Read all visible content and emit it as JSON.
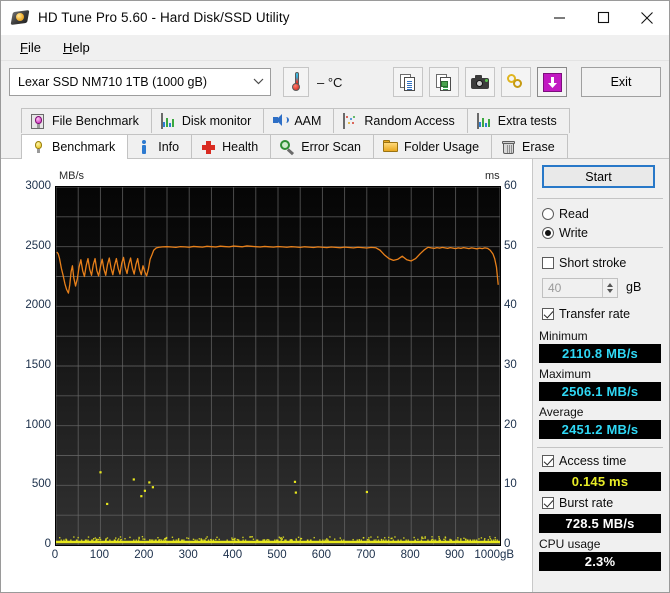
{
  "window": {
    "title": "HD Tune Pro 5.60 - Hard Disk/SSD Utility",
    "minimize": "–",
    "maximize": "□",
    "close": "✕"
  },
  "menu": {
    "items": [
      {
        "label": "File"
      },
      {
        "label": "Help"
      }
    ]
  },
  "toolbar": {
    "drive_value": "Lexar SSD NM710 1TB (1000 gB)",
    "drive_chevron": "⌄",
    "temperature": "– °C",
    "buttons": [
      {
        "name": "copy-to-clipboard-button",
        "icon": "copy-icon"
      },
      {
        "name": "copy-image-button",
        "icon": "copy-image-icon"
      },
      {
        "name": "screenshot-button",
        "icon": "camera-icon"
      },
      {
        "name": "chain-button",
        "icon": "chain-icon"
      },
      {
        "name": "save-button",
        "icon": "down-arrow-icon"
      }
    ],
    "exit_label": "Exit"
  },
  "tabs": {
    "row1": [
      {
        "label": "File Benchmark",
        "icon": "bulb-framed-icon",
        "active": false
      },
      {
        "label": "Disk monitor",
        "icon": "bar-chart-icon",
        "active": false
      },
      {
        "label": "AAM",
        "icon": "speaker-icon",
        "active": false
      },
      {
        "label": "Random Access",
        "icon": "scatter-icon",
        "active": false
      },
      {
        "label": "Extra tests",
        "icon": "bar-chart-icon",
        "active": false
      }
    ],
    "row2": [
      {
        "label": "Benchmark",
        "icon": "bulb-icon",
        "active": true
      },
      {
        "label": "Info",
        "icon": "info-icon",
        "active": false
      },
      {
        "label": "Health",
        "icon": "cross-icon",
        "active": false
      },
      {
        "label": "Error Scan",
        "icon": "magnifier-icon",
        "active": false
      },
      {
        "label": "Folder Usage",
        "icon": "folder-icon",
        "active": false
      },
      {
        "label": "Erase",
        "icon": "trash-icon",
        "active": false
      }
    ]
  },
  "panel": {
    "start_label": "Start",
    "mode": {
      "read_label": "Read",
      "write_label": "Write",
      "selected": "Write"
    },
    "short_stroke": {
      "label": "Short stroke",
      "checked": false,
      "value": "40",
      "unit": "gB"
    },
    "transfer_rate": {
      "label": "Transfer rate",
      "checked": true
    },
    "minimum": {
      "label": "Minimum",
      "value": "2110.8 MB/s"
    },
    "maximum": {
      "label": "Maximum",
      "value": "2506.1 MB/s"
    },
    "average": {
      "label": "Average",
      "value": "2451.2 MB/s"
    },
    "access_time": {
      "label": "Access time",
      "checked": true,
      "value": "0.145 ms"
    },
    "burst_rate": {
      "label": "Burst rate",
      "checked": true,
      "value": "728.5 MB/s"
    },
    "cpu_usage": {
      "label": "CPU usage",
      "value": "2.3%"
    }
  },
  "chart_data": {
    "type": "line",
    "title": "",
    "xlabel": "gB",
    "ylabel": "MB/s",
    "y2label": "ms",
    "xlim": [
      0,
      1000
    ],
    "ylim": [
      0,
      3000
    ],
    "y2lim": [
      0,
      60
    ],
    "grid": true,
    "legend": "none",
    "background": "#0a0a0a",
    "colors": {
      "transfer_rate": "#e8801a",
      "access_time": "#e8e81e"
    },
    "x_ticks": [
      0,
      100,
      200,
      300,
      400,
      500,
      600,
      700,
      800,
      900,
      1000
    ],
    "x_tick_labels": [
      "0",
      "100",
      "200",
      "300",
      "400",
      "500",
      "600",
      "700",
      "800",
      "900",
      "1000gB"
    ],
    "y_ticks": [
      0,
      500,
      1000,
      1500,
      2000,
      2500,
      3000
    ],
    "y_tick_labels": [
      "0",
      "500",
      "1000",
      "1500",
      "2000",
      "2500",
      "3000"
    ],
    "y2_ticks": [
      0,
      10,
      20,
      30,
      40,
      50,
      60
    ],
    "y2_tick_labels": [
      "0",
      "10",
      "20",
      "30",
      "40",
      "50",
      "60"
    ],
    "grid_x_step": 50,
    "grid_y_step": 250,
    "series": [
      {
        "name": "Transfer rate",
        "axis": "left",
        "unit": "MB/s",
        "color": "#e8801a",
        "x": [
          2,
          5,
          8,
          12,
          16,
          20,
          24,
          28,
          31,
          34,
          37,
          40,
          44,
          48,
          52,
          56,
          60,
          64,
          68,
          72,
          76,
          80,
          84,
          88,
          92,
          96,
          100,
          104,
          108,
          112,
          116,
          120,
          124,
          128,
          132,
          136,
          140,
          144,
          148,
          152,
          156,
          160,
          164,
          168,
          172,
          176,
          180,
          184,
          188,
          192,
          196,
          200,
          204,
          208,
          212,
          216,
          220,
          226,
          232,
          240,
          250,
          260,
          270,
          280,
          290,
          300,
          310,
          320,
          330,
          340,
          350,
          360,
          370,
          380,
          390,
          400,
          410,
          420,
          430,
          440,
          450,
          460,
          470,
          480,
          490,
          500,
          510,
          520,
          530,
          540,
          550,
          560,
          570,
          580,
          590,
          600,
          610,
          620,
          630,
          640,
          650,
          660,
          670,
          680,
          690,
          700,
          710,
          720,
          730,
          740,
          750,
          760,
          770,
          780,
          790,
          800,
          810,
          820,
          830,
          838,
          845,
          852,
          858,
          864,
          870,
          876,
          882,
          888,
          894,
          900,
          906,
          912,
          918,
          924,
          930,
          936,
          942,
          948,
          954,
          960,
          966,
          972,
          978,
          984,
          988,
          992,
          996,
          999
        ],
        "y": [
          2455,
          2440,
          2400,
          2320,
          2260,
          2190,
          2140,
          2110.8,
          2180,
          2290,
          2340,
          2240,
          2170,
          2230,
          2330,
          2390,
          2300,
          2250,
          2340,
          2400,
          2310,
          2260,
          2350,
          2400,
          2300,
          2255,
          2330,
          2395,
          2310,
          2260,
          2350,
          2405,
          2320,
          2265,
          2345,
          2400,
          2320,
          2270,
          2360,
          2410,
          2325,
          2275,
          2355,
          2405,
          2320,
          2270,
          2350,
          2400,
          2310,
          2265,
          2340,
          2290,
          2255,
          2310,
          2395,
          2430,
          2470,
          2490,
          2495,
          2498,
          2500,
          2497,
          2494,
          2500,
          2498,
          2495,
          2502,
          2499,
          2496,
          2503,
          2500,
          2497,
          2504,
          2501,
          2498,
          2505,
          2502,
          2499,
          2506.1,
          2503,
          2500,
          2497,
          2502,
          2499,
          2496,
          2501,
          2498,
          2495,
          2500,
          2497,
          2494,
          2499,
          2496,
          2493,
          2498,
          2495,
          2492,
          2497,
          2494,
          2491,
          2496,
          2493,
          2490,
          2495,
          2492,
          2489,
          2494,
          2491,
          2470,
          2430,
          2400,
          2385,
          2395,
          2420,
          2390,
          2380,
          2400,
          2440,
          2475,
          2495,
          2490,
          2486,
          2492,
          2488,
          2494,
          2490,
          2486,
          2492,
          2488,
          2484,
          2490,
          2486,
          2492,
          2488,
          2484,
          2490,
          2486,
          2482,
          2488,
          2484,
          2490,
          2486,
          2470,
          2440,
          2400,
          2330,
          2180
        ]
      },
      {
        "name": "Access time",
        "axis": "right",
        "unit": "ms",
        "color": "#e8e81e",
        "points": [
          {
            "x": 100,
            "y": 12.2
          },
          {
            "x": 115,
            "y": 6.9
          },
          {
            "x": 175,
            "y": 11.0
          },
          {
            "x": 192,
            "y": 8.2
          },
          {
            "x": 200,
            "y": 9.1
          },
          {
            "x": 210,
            "y": 10.5
          },
          {
            "x": 218,
            "y": 9.7
          },
          {
            "x": 538,
            "y": 10.6
          },
          {
            "x": 540,
            "y": 8.8
          },
          {
            "x": 700,
            "y": 8.9
          }
        ],
        "baseline": 0.145,
        "baseline_note": "Dense cluster of access-time samples along 0 ms baseline across full capacity"
      }
    ]
  }
}
